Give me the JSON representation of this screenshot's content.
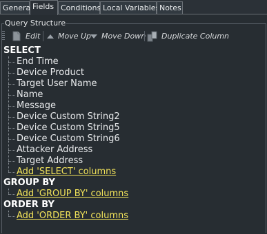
{
  "tabs": [
    {
      "label": "General"
    },
    {
      "label": "Fields"
    },
    {
      "label": "Conditions"
    },
    {
      "label": "Local Variables"
    },
    {
      "label": "Notes"
    }
  ],
  "active_tab": "Fields",
  "group": {
    "title": "Query Structure"
  },
  "toolbar": {
    "edit": "Edit",
    "move_up": "Move Up",
    "move_down": "Move Down",
    "duplicate": "Duplicate Column"
  },
  "select": {
    "header": "SELECT",
    "columns": [
      "End Time",
      "Device Product",
      "Target User Name",
      "Name",
      "Message",
      "Device Custom String2",
      "Device Custom String5",
      "Device Custom String6",
      "Attacker Address",
      "Target Address"
    ],
    "add_link": "Add 'SELECT' columns"
  },
  "group_by": {
    "header": "GROUP BY",
    "add_link": "Add 'GROUP BY' columns"
  },
  "order_by": {
    "header": "ORDER BY",
    "add_link": "Add 'ORDER BY' columns"
  },
  "colors": {
    "link": "#f2e35a",
    "background": "#272d32"
  }
}
